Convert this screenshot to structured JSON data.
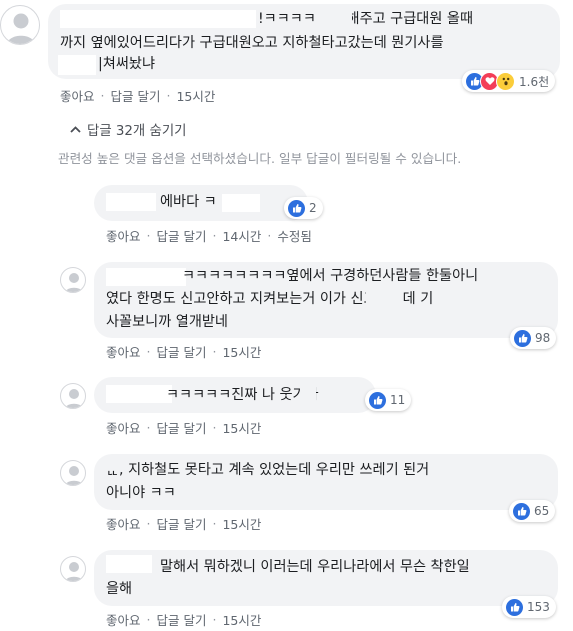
{
  "colors": {
    "like": "#2d6fde",
    "heart": "#f33e58",
    "wow": "#fbcd3a",
    "bubble": "#f2f3f5",
    "meta": "#606770"
  },
  "actions": {
    "like": "좋아요",
    "reply": "답글 달기",
    "sep": "·",
    "edited": "수정됨"
  },
  "top_comment": {
    "line1": "!ㅋㅋㅋㅋ       신고해주고 구급대원 올때",
    "line2": "까지 옆에있어드리다가 구급대원오고 지하철타고갔는데 뭔기사를",
    "line3": "|쳐써놨냐",
    "time": "15시간",
    "reactions": {
      "icons": [
        "like-icon",
        "heart-icon",
        "wow-icon"
      ],
      "count": "1.6천"
    }
  },
  "replies_toggle": {
    "label": "답글 32개 숨기기",
    "icon": "chevron-up-icon"
  },
  "filter_notice": "관련성 높은 댓글 옵션을 선택하셨습니다. 일부 답글이 필터링될 수 있습니다.",
  "replies": [
    {
      "lines": [
        "에바다 ㅋ       ㅋㅋ"
      ],
      "time": "14시간",
      "edited": true,
      "reaction_count": "2"
    },
    {
      "lines": [
        "ㅋㅋㅋㅋㅋㅋㅋㅋ옆에서 구경하던사람들 한둘아니",
        "였다 한명도 신고안하고 지켜보는거       이가 신고했는데 기",
        "사꼴보니까 열개받네"
      ],
      "time": "15시간",
      "reaction_count": "98"
    },
    {
      "lines": [
        "ㅋㅋㅋㅋㅋ진짜     나 웃기다"
      ],
      "time": "15시간",
      "reaction_count": "11"
    },
    {
      "lines": [
        "ᆫᆫ, 지하철도 못타고 계속 있었는데 우리만 쓰레기 된거",
        "아니야 ㅋㅋ"
      ],
      "time": "15시간",
      "reaction_count": "65"
    },
    {
      "lines": [
        "말해서 뭐하겠니 이러는데 우리나라에서 무슨 착한일",
        "을해"
      ],
      "time": "15시간",
      "reaction_count": "153"
    }
  ]
}
